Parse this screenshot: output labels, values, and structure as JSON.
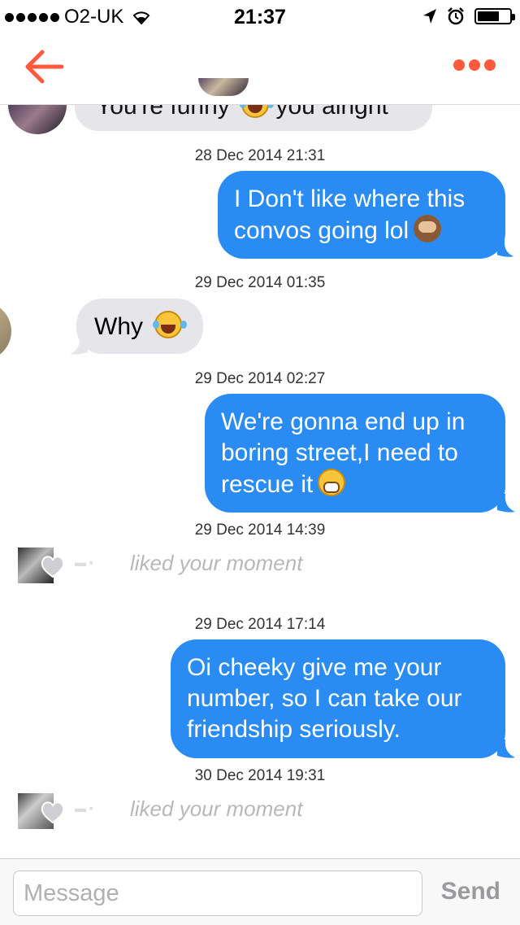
{
  "status_bar": {
    "carrier": "O2-UK",
    "time": "21:37"
  },
  "nav": {
    "back_icon": "arrow-left-icon",
    "more_icon": "ellipsis-icon",
    "accent_color": "#ff5a3c"
  },
  "messages": [
    {
      "kind": "incoming",
      "text": "You're funny",
      "text2": "you alright",
      "emoji": "laughing-crying"
    },
    {
      "kind": "timestamp",
      "text": "28 Dec 2014 21:31"
    },
    {
      "kind": "outgoing",
      "line1": "I Don't like where this",
      "line2": "convos going lol",
      "emoji": "see-no-evil-monkey"
    },
    {
      "kind": "timestamp",
      "text": "29 Dec 2014 01:35"
    },
    {
      "kind": "incoming",
      "text": "Why",
      "emoji": "laughing-crying"
    },
    {
      "kind": "timestamp",
      "text": "29 Dec 2014 02:27"
    },
    {
      "kind": "outgoing",
      "line1": "We're gonna end up in",
      "line2": "boring street,I need to",
      "line3": "rescue it",
      "emoji": "grimacing-face"
    },
    {
      "kind": "timestamp",
      "text": "29 Dec 2014 14:39"
    },
    {
      "kind": "liked",
      "text": "liked your moment"
    },
    {
      "kind": "timestamp",
      "text": "29 Dec 2014 17:14"
    },
    {
      "kind": "outgoing",
      "line1": "Oi cheeky give me your",
      "line2": "number, so I can take our",
      "line3": "friendship seriously."
    },
    {
      "kind": "timestamp",
      "text": "30 Dec 2014 19:31"
    },
    {
      "kind": "liked",
      "text": "liked your moment"
    }
  ],
  "composer": {
    "placeholder": "Message",
    "send_label": "Send"
  },
  "colors": {
    "outgoing_bubble": "#2a8cf2",
    "incoming_bubble": "#e5e5ea"
  }
}
